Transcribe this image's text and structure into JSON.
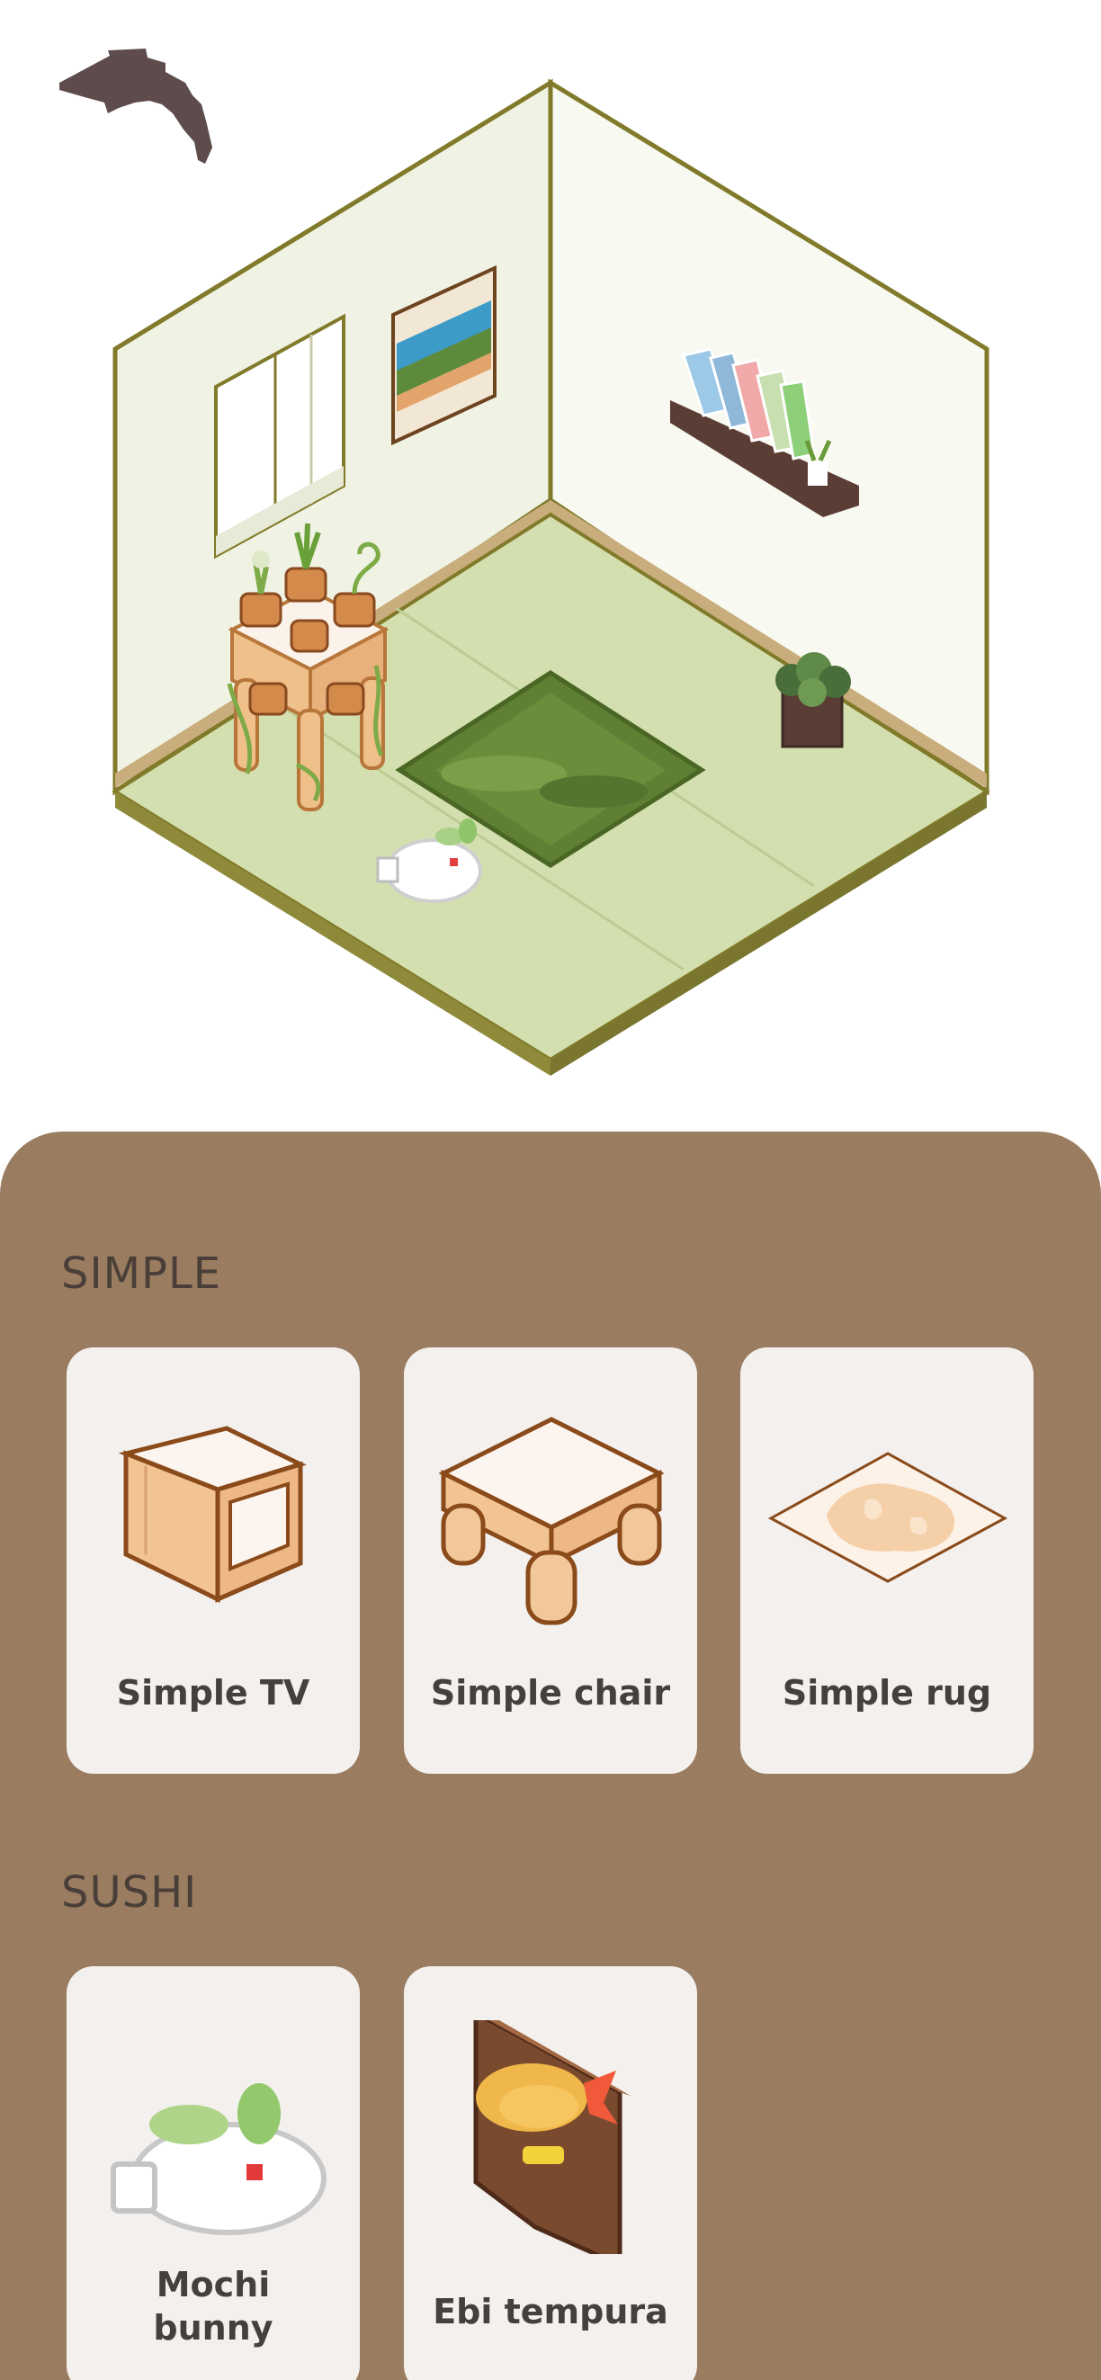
{
  "nav": {
    "back_icon": "back-arrow-icon"
  },
  "room": {
    "items": [
      "window",
      "calendar-poster",
      "bookshelf",
      "plant-stand",
      "grass-rug",
      "potted-plant",
      "mochi-bunny"
    ]
  },
  "sections": [
    {
      "title": "SIMPLE",
      "items": [
        {
          "label": "Simple TV",
          "icon": "simple-tv-icon"
        },
        {
          "label": "Simple chair",
          "icon": "simple-chair-icon"
        },
        {
          "label": "Simple rug",
          "icon": "simple-rug-icon"
        }
      ]
    },
    {
      "title": "SUSHI",
      "items": [
        {
          "label": "Mochi\nbunny",
          "icon": "mochi-bunny-icon"
        },
        {
          "label": "Ebi tempura",
          "icon": "ebi-tempura-icon"
        }
      ]
    }
  ],
  "colors": {
    "panel": "#9a7c60",
    "card": "#f3f0ee",
    "wall": "#f4f6ea",
    "floor": "#d3dfae",
    "outline": "#7d7a2d",
    "back_arrow": "#5a4a4a"
  }
}
